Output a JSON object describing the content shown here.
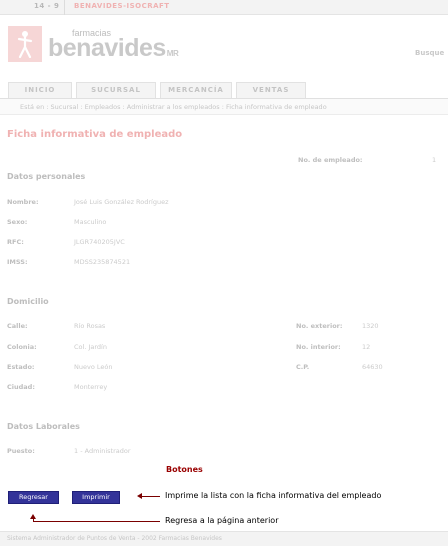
{
  "topbar": {
    "code": "14 - 9",
    "brand": "BENAVIDES-ISOCRAFT"
  },
  "logo": {
    "small": "farmacias",
    "big": "benavides",
    "tm": "MR"
  },
  "header": {
    "search_label": "Busque"
  },
  "tabs": [
    {
      "label": "INICIO"
    },
    {
      "label": "SUCURSAL"
    },
    {
      "label": "MERCANCÍA"
    },
    {
      "label": "VENTAS"
    }
  ],
  "breadcrumb": "Está en : Sucursal : Empleados : Administrar a los empleados : Ficha informativa de empleado",
  "page_title": "Ficha informativa de empleado",
  "employee_number": {
    "label": "No. de empleado:",
    "value": "1"
  },
  "personal": {
    "title": "Datos personales",
    "fields": [
      {
        "label": "Nombre:",
        "value": "José Luis González Rodríguez"
      },
      {
        "label": "Sexo:",
        "value": "Masculino"
      },
      {
        "label": "RFC:",
        "value": "JLGR740205JVC"
      },
      {
        "label": "IMSS:",
        "value": "MDSS235874521"
      }
    ]
  },
  "domicilio": {
    "title": "Domicilio",
    "calle": {
      "label": "Calle:",
      "value": "Río Rosas"
    },
    "colonia": {
      "label": "Colonia:",
      "value": "Col. Jardín"
    },
    "estado": {
      "label": "Estado:",
      "value": "Nuevo León"
    },
    "ciudad": {
      "label": "Ciudad:",
      "value": "Monterrey"
    },
    "no_exterior": {
      "label": "No. exterior:",
      "value": "1320"
    },
    "no_interior": {
      "label": "No. interior:",
      "value": "12"
    },
    "cp": {
      "label": "C.P.",
      "value": "64630"
    }
  },
  "laborales": {
    "title": "Datos Laborales",
    "puesto": {
      "label": "Puesto:",
      "value": "1  -  Administrador"
    }
  },
  "botones": {
    "title": "Botones",
    "regresar": "Regresar",
    "imprimir": "Imprimir",
    "note_imprimir": "Imprime la lista con la ficha informativa del empleado",
    "note_regresar": "Regresa a la página anterior"
  },
  "footer": "Sistema Administrador de Puntos de Venta - 2002 Farmacias Benavides",
  "colors": {
    "accent_red": "#990000",
    "button_blue": "#333399",
    "title_pink": "#f0b2b2"
  }
}
